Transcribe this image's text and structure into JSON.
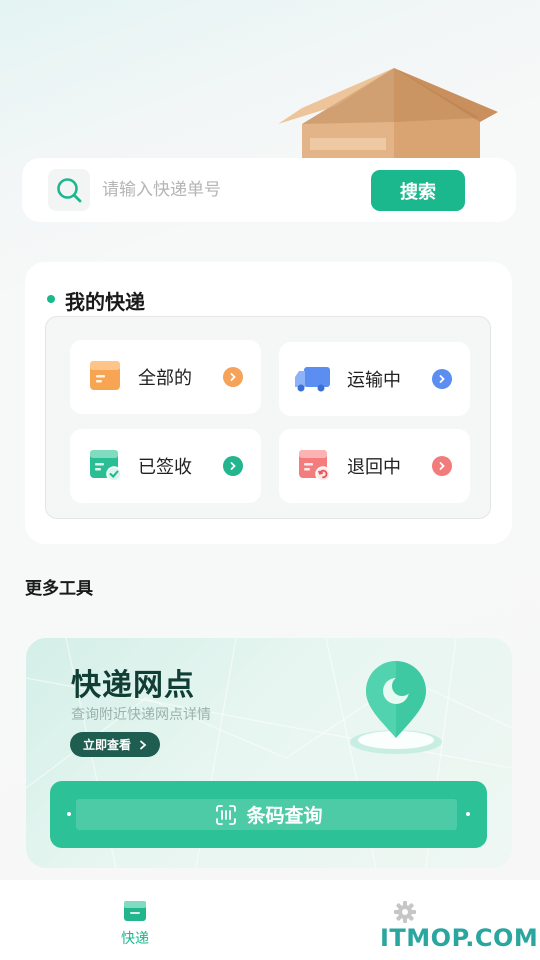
{
  "search": {
    "placeholder": "请输入快递单号",
    "value": "",
    "button_label": "搜索",
    "icon": "search-icon"
  },
  "my_express": {
    "title": "我的快递",
    "items": [
      {
        "label": "全部的",
        "icon": "package-icon",
        "accent": "#f5a25a"
      },
      {
        "label": "运输中",
        "icon": "truck-icon",
        "accent": "#5b8ef0"
      },
      {
        "label": "已签收",
        "icon": "signed-package-icon",
        "accent": "#22b58e"
      },
      {
        "label": "退回中",
        "icon": "return-package-icon",
        "accent": "#f27b7b"
      }
    ]
  },
  "more_tools": {
    "title": "更多工具",
    "outlet_card": {
      "title": "快递网点",
      "subtitle": "查询附近快递网点详情",
      "button_label": "立即查看",
      "icon": "location-pin-icon"
    },
    "barcode": {
      "label": "条码查询",
      "icon": "barcode-scan-icon"
    }
  },
  "tabbar": {
    "tabs": [
      {
        "label": "快递",
        "icon": "package-tab-icon",
        "active": true
      },
      {
        "label": "设置",
        "icon": "gear-icon",
        "active": false
      }
    ]
  },
  "watermark": "ITMOP.COM",
  "colors": {
    "primary": "#1bb88e",
    "primary_dark": "#1f5d50",
    "page_bg": "#f7f7f7"
  }
}
